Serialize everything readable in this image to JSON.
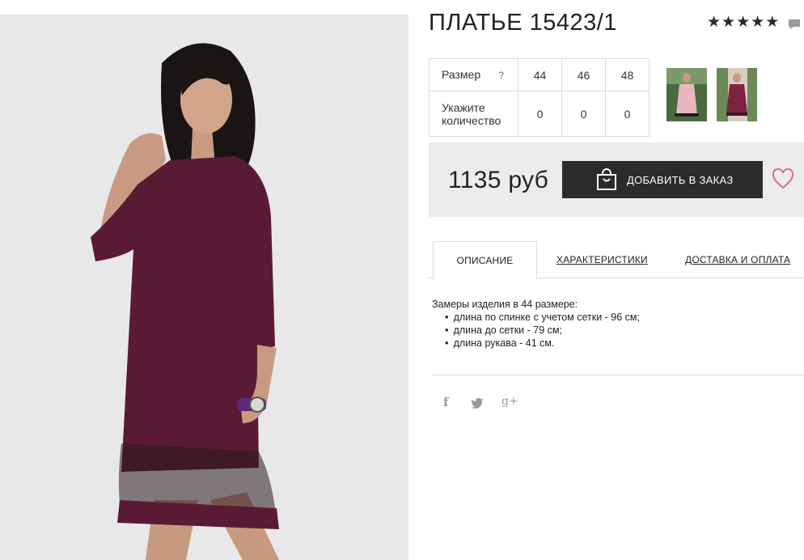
{
  "product": {
    "title": "ПЛАТЬЕ 15423/1",
    "rating": [
      "★",
      "★",
      "★",
      "★",
      "★"
    ]
  },
  "sizes": {
    "label": "Размер",
    "help": "?",
    "values": [
      "44",
      "46",
      "48"
    ],
    "quantity_label_line1": "Укажите",
    "quantity_label_line2": "количество",
    "quantities": [
      "0",
      "0",
      "0"
    ]
  },
  "purchase": {
    "price": "1135 руб",
    "add_label": "ДОБАВИТЬ В ЗАКАЗ"
  },
  "tabs": [
    {
      "label": "ОПИСАНИЕ",
      "active": true
    },
    {
      "label": "ХАРАКТЕРИСТИКИ",
      "active": false
    },
    {
      "label": "ДОСТАВКА И ОПЛАТА",
      "active": false
    }
  ],
  "description": {
    "intro": "Замеры изделия в 44 размере:",
    "items": [
      "длина по спинке с учетом сетки - 96 см;",
      "длина до сетки - 79 см;",
      "длина рукава - 41 см."
    ]
  },
  "social": {
    "facebook": "f",
    "twitter": "t",
    "google": "g+"
  },
  "colors": {
    "dress": "#5b1a34",
    "button": "#2b2b2b",
    "price_bg": "#ececec",
    "heart": "#d9708a"
  }
}
